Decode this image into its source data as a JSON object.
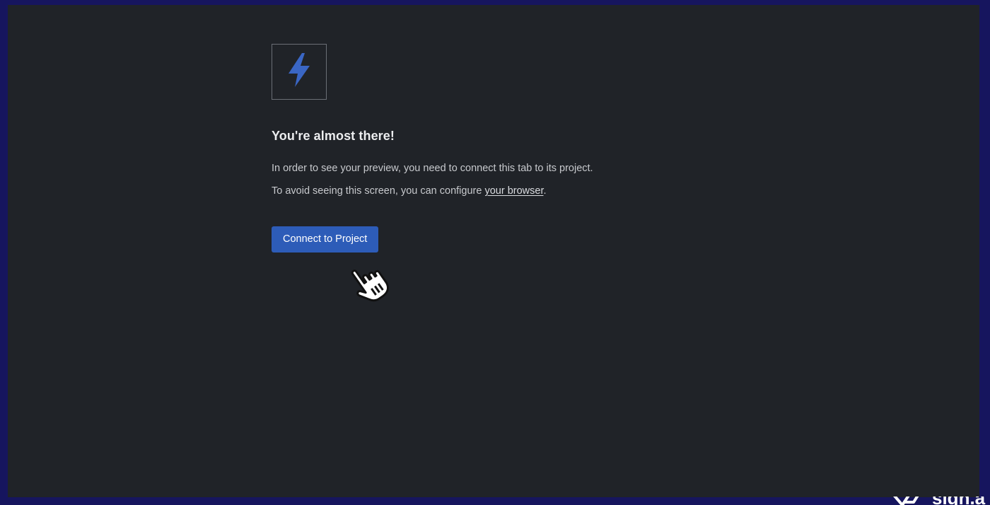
{
  "page": {
    "logo_icon": "lightning-bolt-icon",
    "headline": "You're almost there!",
    "paragraph_1": "In order to see your preview, you need to connect this tab to its project.",
    "paragraph_2_prefix": "To avoid seeing this screen, you can configure ",
    "paragraph_2_link": "your browser",
    "paragraph_2_suffix": ".",
    "connect_button_label": "Connect to Project"
  },
  "watermark": {
    "text": "sign.a",
    "icon": "brand-logo-icon"
  },
  "colors": {
    "outer_background": "#16155e",
    "page_background": "#202328",
    "accent": "#2d5cb8",
    "bolt": "#3a66c4"
  }
}
